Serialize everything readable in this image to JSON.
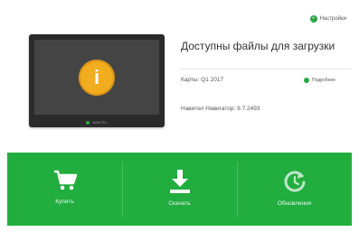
{
  "header": {
    "settings_label": "Настройки"
  },
  "device": {
    "brand": "NAVITEL"
  },
  "main": {
    "title": "Доступны файлы для загрузки",
    "maps_line": "Карты: Q1 2017",
    "details_label": "Подробнее",
    "navigator_line": "Навител Навигатор: 9.7.2493"
  },
  "actions": [
    {
      "label": "Купить",
      "icon": "cart-icon"
    },
    {
      "label": "Скачать",
      "icon": "download-icon"
    },
    {
      "label": "Обновления",
      "icon": "refresh-icon"
    }
  ],
  "colors": {
    "accent": "#22ad3f",
    "info": "#f2ad1e"
  }
}
